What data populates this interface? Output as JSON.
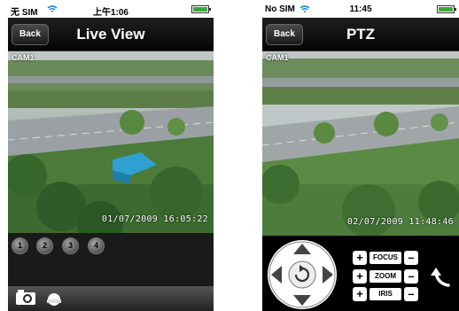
{
  "left_screen": {
    "status": {
      "carrier": "无 SIM",
      "time": "上午1:06"
    },
    "nav": {
      "back_label": "Back",
      "title": "Live View"
    },
    "video": {
      "camera_label": "CAM1",
      "timestamp": "01/07/2009 16:05:22"
    },
    "channels": [
      "1",
      "2",
      "3",
      "4"
    ],
    "toolbar": {
      "icons": [
        "camera-icon",
        "ptz-icon"
      ]
    }
  },
  "right_screen": {
    "status": {
      "carrier": "No SIM",
      "time": "11:45"
    },
    "nav": {
      "back_label": "Back",
      "title": "PTZ"
    },
    "video": {
      "camera_label": "CAM1",
      "timestamp": "02/07/2009 11:48:46"
    },
    "controls": [
      {
        "label": "FOCUS",
        "minus": "–",
        "plus": "+"
      },
      {
        "label": "ZOOM",
        "minus": "–",
        "plus": "+"
      },
      {
        "label": "IRIS",
        "minus": "–",
        "plus": "+"
      }
    ],
    "dpad": {
      "icons": [
        "arrow-up-icon",
        "arrow-down-icon",
        "arrow-left-icon",
        "arrow-right-icon",
        "refresh-icon"
      ]
    }
  },
  "colors": {
    "status_bg": "#ffffff",
    "nav_bg": "#101010",
    "wifi": "#1a7fd6",
    "battery": "#3aa93a"
  }
}
